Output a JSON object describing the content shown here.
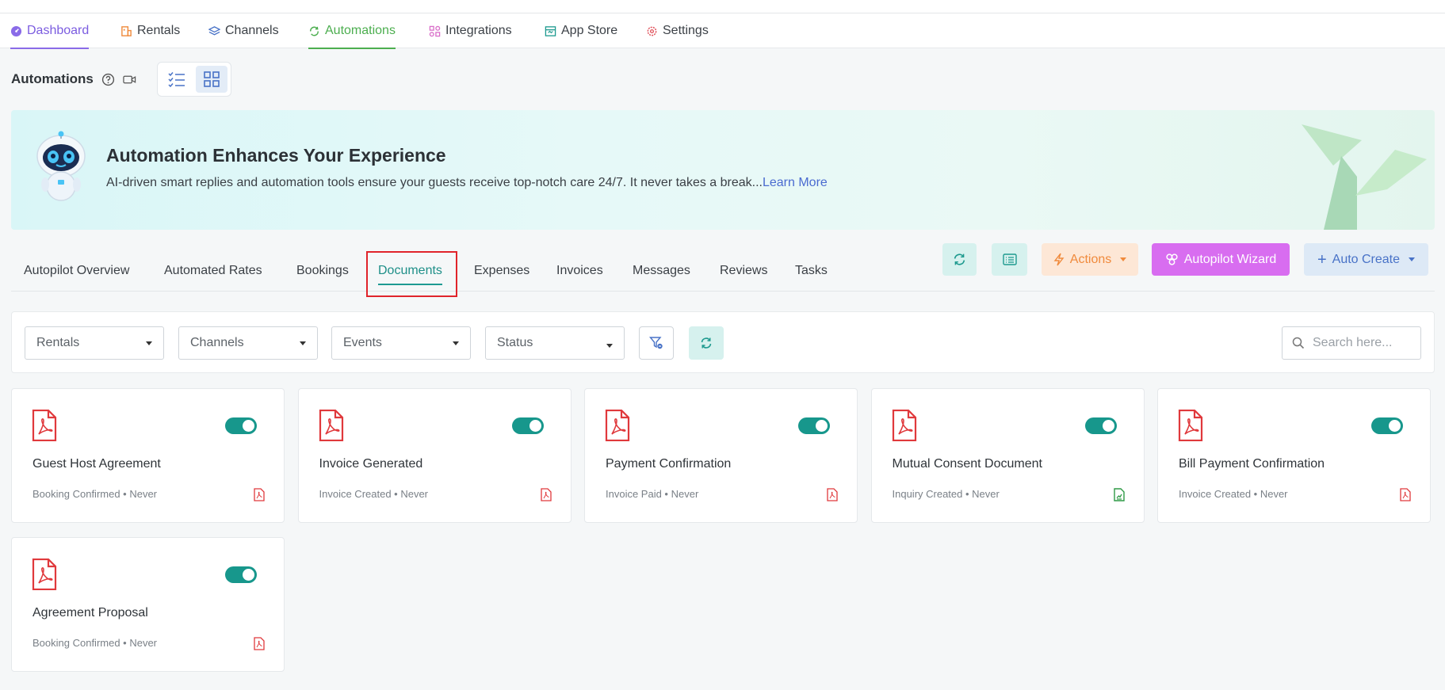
{
  "nav": {
    "items": [
      {
        "label": "Dashboard",
        "icon": "dashboard-icon"
      },
      {
        "label": "Rentals",
        "icon": "rentals-icon"
      },
      {
        "label": "Channels",
        "icon": "channels-icon"
      },
      {
        "label": "Automations",
        "icon": "automations-icon"
      },
      {
        "label": "Integrations",
        "icon": "integrations-icon"
      },
      {
        "label": "App Store",
        "icon": "app-store-icon"
      },
      {
        "label": "Settings",
        "icon": "settings-icon"
      }
    ]
  },
  "page": {
    "title": "Automations"
  },
  "banner": {
    "title": "Automation Enhances Your Experience",
    "text": "AI-driven smart replies and automation tools ensure your guests receive top-notch care 24/7. It never takes a break...",
    "link": "Learn More"
  },
  "subtabs": [
    "Autopilot Overview",
    "Automated Rates",
    "Bookings",
    "Documents",
    "Expenses",
    "Invoices",
    "Messages",
    "Reviews",
    "Tasks"
  ],
  "actions": {
    "actions_label": "Actions",
    "wizard_label": "Autopilot Wizard",
    "auto_create_label": "Auto Create"
  },
  "filters": {
    "rentals": "Rentals",
    "channels": "Channels",
    "events": "Events",
    "status": "Status",
    "search_placeholder": "Search here..."
  },
  "cards": [
    {
      "title": "Guest Host Agreement",
      "meta": "Booking Confirmed • Never",
      "enabled": true,
      "file_icon": "pdf-icon"
    },
    {
      "title": "Invoice Generated",
      "meta": "Invoice Created • Never",
      "enabled": true,
      "file_icon": "pdf-icon"
    },
    {
      "title": "Payment Confirmation",
      "meta": "Invoice Paid • Never",
      "enabled": true,
      "file_icon": "pdf-icon"
    },
    {
      "title": "Mutual Consent Document",
      "meta": "Inquiry Created • Never",
      "enabled": true,
      "file_icon": "signed-doc-icon"
    },
    {
      "title": "Bill Payment Confirmation",
      "meta": "Invoice Created • Never",
      "enabled": true,
      "file_icon": "pdf-icon"
    },
    {
      "title": "Agreement Proposal",
      "meta": "Booking Confirmed • Never",
      "enabled": true,
      "file_icon": "pdf-icon"
    }
  ],
  "colors": {
    "accent_teal": "#17978c",
    "pdf_red": "#e0393c",
    "wizard_purple": "#d86df0",
    "nav_active_green": "#4cae4f",
    "nav_dashboard_purple": "#7b5ce0"
  }
}
